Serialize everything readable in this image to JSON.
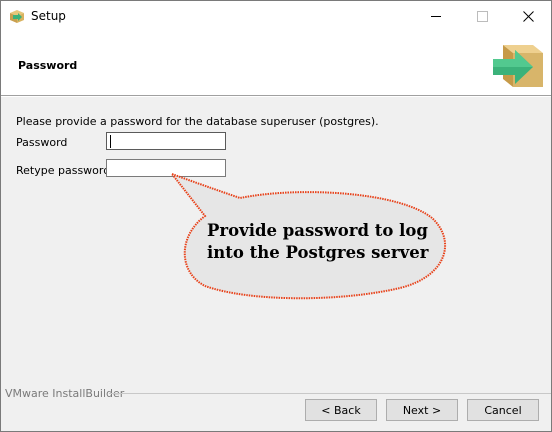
{
  "window": {
    "title": "Setup",
    "icon": "installer-box-icon"
  },
  "header": {
    "title": "Password",
    "logo": "installer-box-arrow-icon"
  },
  "content": {
    "prompt": "Please provide a password for the database superuser (postgres).",
    "password_label": "Password",
    "password_value": "",
    "retype_label": "Retype password",
    "retype_value": ""
  },
  "callout": {
    "line1": "Provide password to log",
    "line2": "into the Postgres server",
    "fill": "#e6e6e6",
    "border": "#e8421a"
  },
  "footer": {
    "brand": "VMware InstallBuilder",
    "back_label": "< Back",
    "next_label": "Next >",
    "cancel_label": "Cancel"
  },
  "colors": {
    "box_tan": "#d8b56a",
    "arrow_green": "#3bb27a"
  }
}
